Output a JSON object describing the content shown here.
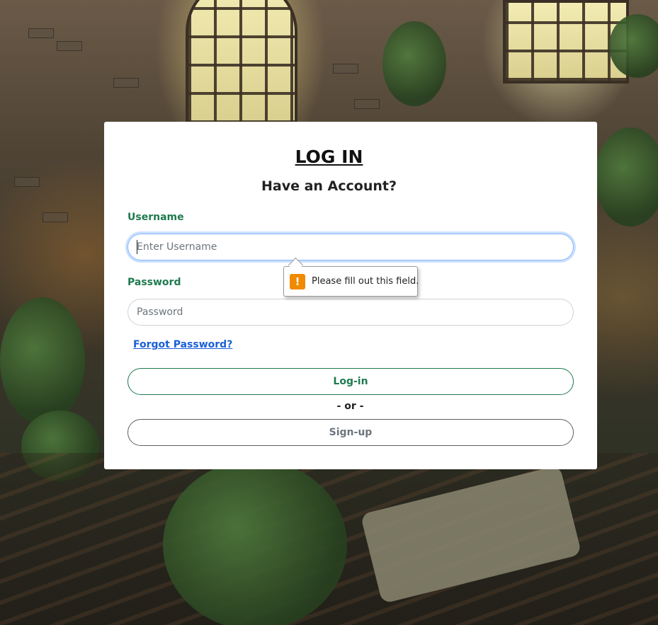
{
  "login": {
    "title": "LOG IN",
    "subtitle": "Have an Account?",
    "username_label": "Username",
    "username_placeholder": "Enter Username",
    "password_label": "Password",
    "password_placeholder": "Password",
    "validation_message": "Please fill out this field.",
    "forgot_password": "Forgot Password?",
    "login_button": "Log-in",
    "separator": "- or -",
    "signup_button": "Sign-up"
  },
  "colors": {
    "accent_green": "#1f7a4f",
    "link_blue": "#1a5fd6",
    "warning_orange": "#f08a00",
    "focus_ring": "#86b7fe"
  },
  "icons": {
    "warning": "warning-icon"
  }
}
